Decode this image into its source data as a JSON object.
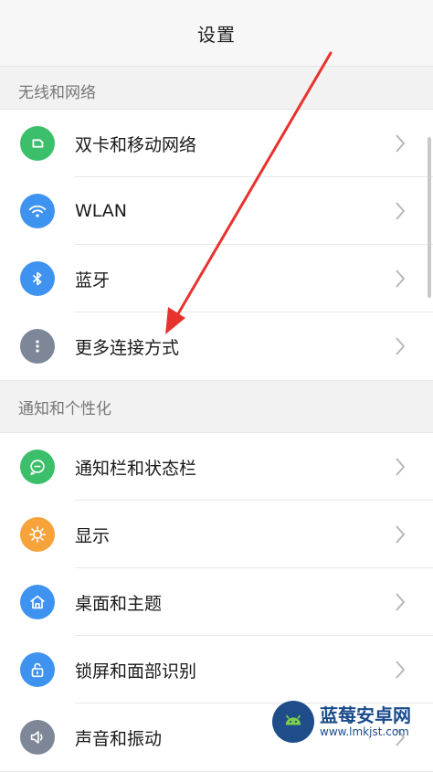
{
  "header": {
    "title": "设置"
  },
  "sections": [
    {
      "title": "无线和网络",
      "items": [
        {
          "label": "双卡和移动网络",
          "icon": "sim-card-icon",
          "color": "#3bbf6a"
        },
        {
          "label": "WLAN",
          "icon": "wifi-icon",
          "color": "#3f93f0"
        },
        {
          "label": "蓝牙",
          "icon": "bluetooth-icon",
          "color": "#3f93f0"
        },
        {
          "label": "更多连接方式",
          "icon": "more-dots-icon",
          "color": "#7e8797"
        }
      ]
    },
    {
      "title": "通知和个性化",
      "items": [
        {
          "label": "通知栏和状态栏",
          "icon": "notification-icon",
          "color": "#3bbf6a"
        },
        {
          "label": "显示",
          "icon": "brightness-icon",
          "color": "#f5a33a"
        },
        {
          "label": "桌面和主题",
          "icon": "home-icon",
          "color": "#3f93f0"
        },
        {
          "label": "锁屏和面部识别",
          "icon": "lock-icon",
          "color": "#3f93f0"
        },
        {
          "label": "声音和振动",
          "icon": "speaker-icon",
          "color": "#7e8797"
        }
      ]
    }
  ],
  "annotation": {
    "color": "#e8322d"
  },
  "watermark": {
    "name": "蓝莓安卓网",
    "url": "www.lmkjst.com"
  }
}
